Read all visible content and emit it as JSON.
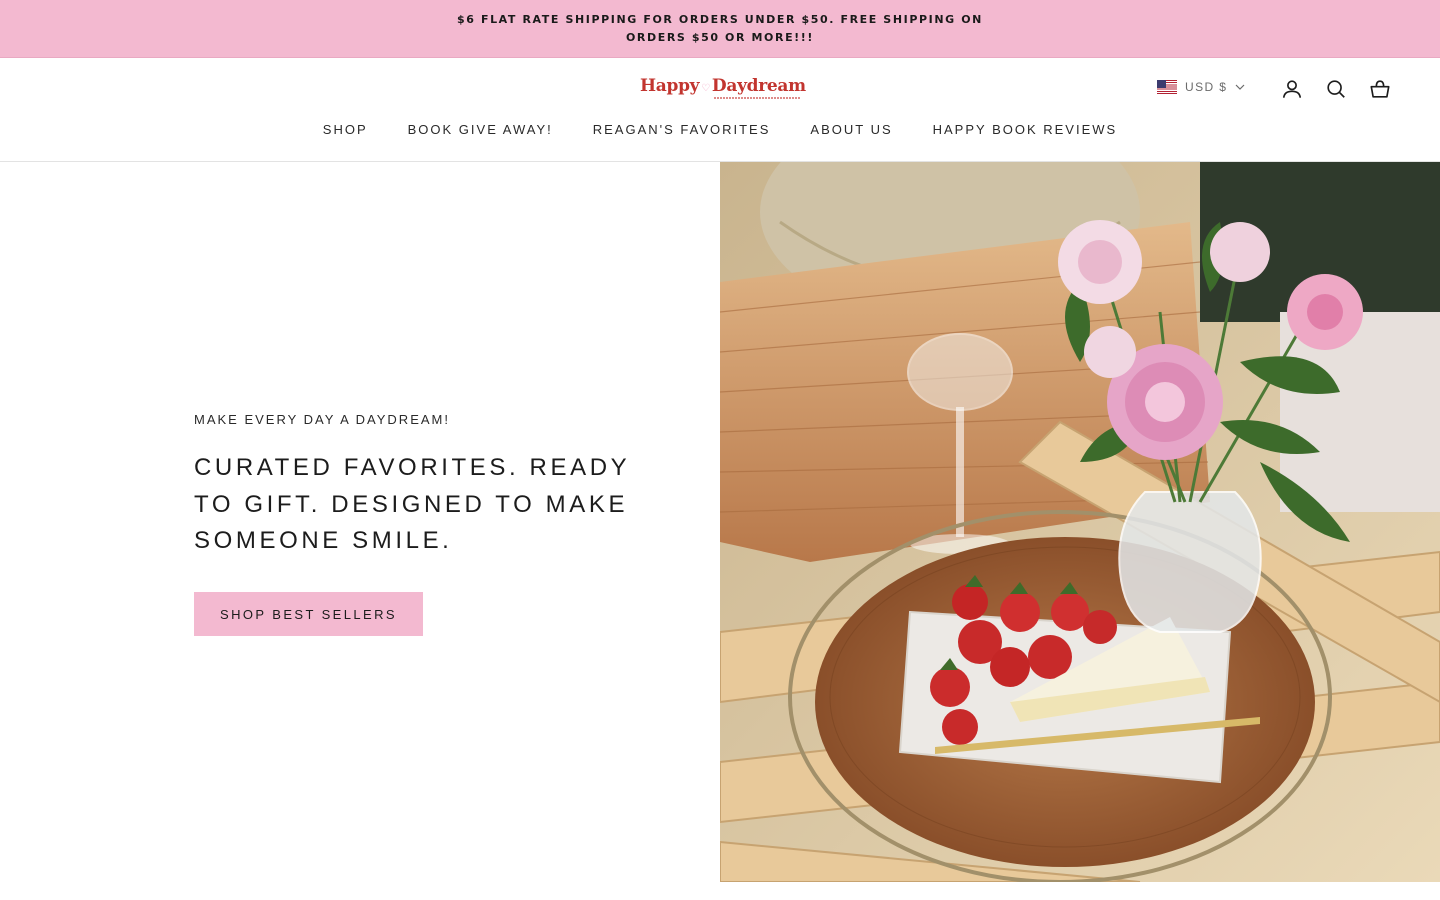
{
  "announcement": {
    "text": "$6 FLAT RATE SHIPPING FOR ORDERS UNDER $50. FREE SHIPPING ON ORDERS $50 OR MORE!!!"
  },
  "header": {
    "logo": {
      "word1": "Happy",
      "word2": "Daydream"
    },
    "currency": {
      "label": "USD $",
      "flag_icon": "us-flag-icon"
    },
    "icons": [
      "account-icon",
      "search-icon",
      "cart-icon"
    ],
    "nav": [
      {
        "label": "SHOP"
      },
      {
        "label": "BOOK GIVE AWAY!"
      },
      {
        "label": "REAGAN'S FAVORITES"
      },
      {
        "label": "ABOUT US"
      },
      {
        "label": "HAPPY BOOK REVIEWS"
      }
    ]
  },
  "hero": {
    "eyebrow": "MAKE EVERY DAY A DAYDREAM!",
    "headline": "CURATED FAVORITES. READY TO GIFT. DESIGNED TO MAKE SOMEONE SMILE.",
    "cta_label": "SHOP BEST SELLERS",
    "image": "picnic-basket-peonies-strawberries-cheese-tray"
  },
  "colors": {
    "accent_pink": "#f3b9d0",
    "logo_red": "#c2352f",
    "text_dark": "#1c1c1c"
  }
}
